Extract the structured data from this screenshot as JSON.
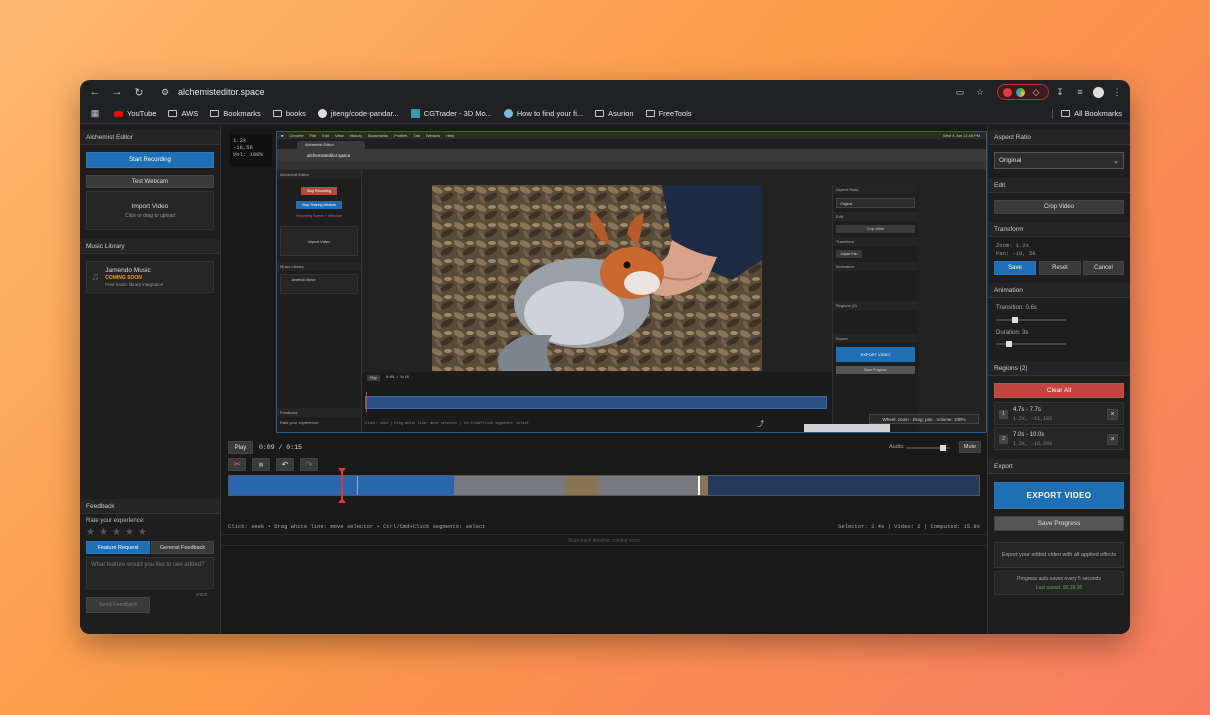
{
  "browser": {
    "url": "alchemisteditor.space",
    "bookmarks": [
      "YouTube",
      "AWS",
      "Bookmarks",
      "books",
      "jiteng/code-pandar...",
      "CGTrader - 3D Mo...",
      "How to find your fi...",
      "Asurion",
      "FreeTools"
    ],
    "all_bookmarks": "All Bookmarks"
  },
  "left": {
    "title": "Alchemist Editor",
    "start_recording": "Start Recording",
    "test_webcam": "Test Webcam",
    "import_title": "Import Video",
    "import_sub": "Click or drag to upload",
    "music_title": "Music Library",
    "jamendo_title": "Jamendo Music",
    "jamendo_badge": "COMING SOON",
    "jamendo_sub": "Free music library integration",
    "feedback_title": "Feedback",
    "rate": "Rate your experience:",
    "tab_feature": "Feature Request",
    "tab_general": "General Feedback",
    "textarea_placeholder": "What feature would you like to see added?",
    "char_count": "0/500",
    "send": "Send Feedback"
  },
  "preview": {
    "zoom_overlay": "1.2x",
    "pan_overlay": "-18,56",
    "vol_overlay": "Vol: 100%",
    "macbar_items": [
      "Chrome",
      "File",
      "Edit",
      "View",
      "History",
      "Bookmarks",
      "Profiles",
      "Tab",
      "Window",
      "Help"
    ],
    "mac_clock": "Wed 4 Jun  11:49 PM",
    "inner_tab": "Alchemist Editor",
    "inner_url": "alchemisteditor.space",
    "inner_left_title": "Alchemist Editor",
    "inner_stop": "Stop Recording",
    "inner_stop_window": "Stop Sharing Window",
    "inner_rec_text": "Recording Screen + Webcam",
    "inner_import": "Import Video",
    "inner_music": "Music Library",
    "inner_jamendo": "Jamendo Music",
    "inner_feedback": "Feedback",
    "inner_rate": "Rate your experience:",
    "inner_right_aspect": "Aspect Ratio",
    "inner_right_original": "Original",
    "inner_right_edit": "Edit",
    "inner_right_crop": "Crop Video",
    "inner_right_transform": "Transform",
    "inner_right_adjust": "Adjust Pan",
    "inner_right_animation": "Animation",
    "inner_right_regions": "Regions (0)",
    "inner_right_export": "Export",
    "inner_right_export_btn": "EXPORT VIDEO",
    "inner_right_save": "Save Progress",
    "inner_play": "Play",
    "inner_time": "0:09 / 0:15",
    "inner_hint": "Click: seek | Drag white line: move selector | Ctrl/Cmd+Click segments: select",
    "tooltip": "Wheel: zoom · Drag: pan · Volume: 100%"
  },
  "timeline": {
    "play": "Play",
    "time": "0:09 / 0:15",
    "audio": "Audio:",
    "mute": "Mute",
    "hint": "Click: seek • Drag white line: move selector • Ctrl/Cmd+Click segments: select",
    "status": "Selector: 2.4s | Video: 2 | Computed: 15.8s",
    "footer": "Multi-track timeline coming soon",
    "audio_level": 0.9,
    "playhead_position_s": 2.4
  },
  "right": {
    "aspect_title": "Aspect Ratio",
    "aspect_value": "Original",
    "edit_title": "Edit",
    "crop": "Crop Video",
    "transform_title": "Transform",
    "zoom": "Zoom: 1.2x",
    "pan": "Pan: -18, 56",
    "save": "Save",
    "reset": "Reset",
    "cancel": "Cancel",
    "animation_title": "Animation",
    "transition": "Transition: 0.6s",
    "duration": "Duration: 3s",
    "transition_level": 0.25,
    "duration_level": 0.15,
    "regions_title": "Regions (2)",
    "clear_all": "Clear All",
    "regions": [
      {
        "num": "1",
        "time": "4.7s - 7.7s",
        "coords": "1.2x, -11,183"
      },
      {
        "num": "2",
        "time": "7.0s - 10.0s",
        "coords": "1.2x, -18,293"
      }
    ],
    "export_title": "Export",
    "export_btn": "EXPORT VIDEO",
    "save_progress": "Save Progress",
    "export_note": "Export your edited video with all applied effects",
    "autosave": "Progress auto-saves every 5 seconds",
    "last_saved": "Last saved: 00:39:38"
  },
  "colors": {
    "accent": "#1e6fb4",
    "danger": "#c0443f",
    "timeline_blue": "#2a66ad"
  }
}
